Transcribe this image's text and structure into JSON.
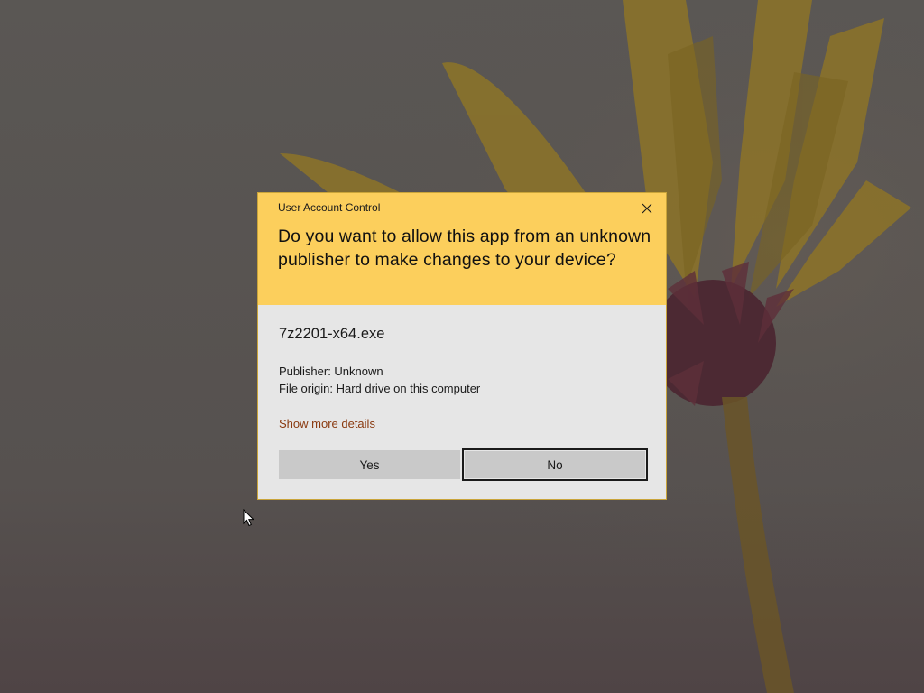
{
  "dialog": {
    "title": "User Account Control",
    "question": "Do you want to allow this app from an unknown publisher to make changes to your device?",
    "app_name": "7z2201-x64.exe",
    "publisher": "Publisher: Unknown",
    "file_origin": "File origin: Hard drive on this computer",
    "more_details_link": "Show more details",
    "yes_label": "Yes",
    "no_label": "No",
    "close_icon": "close-icon",
    "colors": {
      "header": "#fccf5c",
      "body": "#e6e6e6",
      "button": "#c9c9c9",
      "link": "#8a3a10",
      "desktop": "#575350"
    }
  },
  "desktop": {
    "cursor_icon": "mouse-pointer-icon"
  }
}
